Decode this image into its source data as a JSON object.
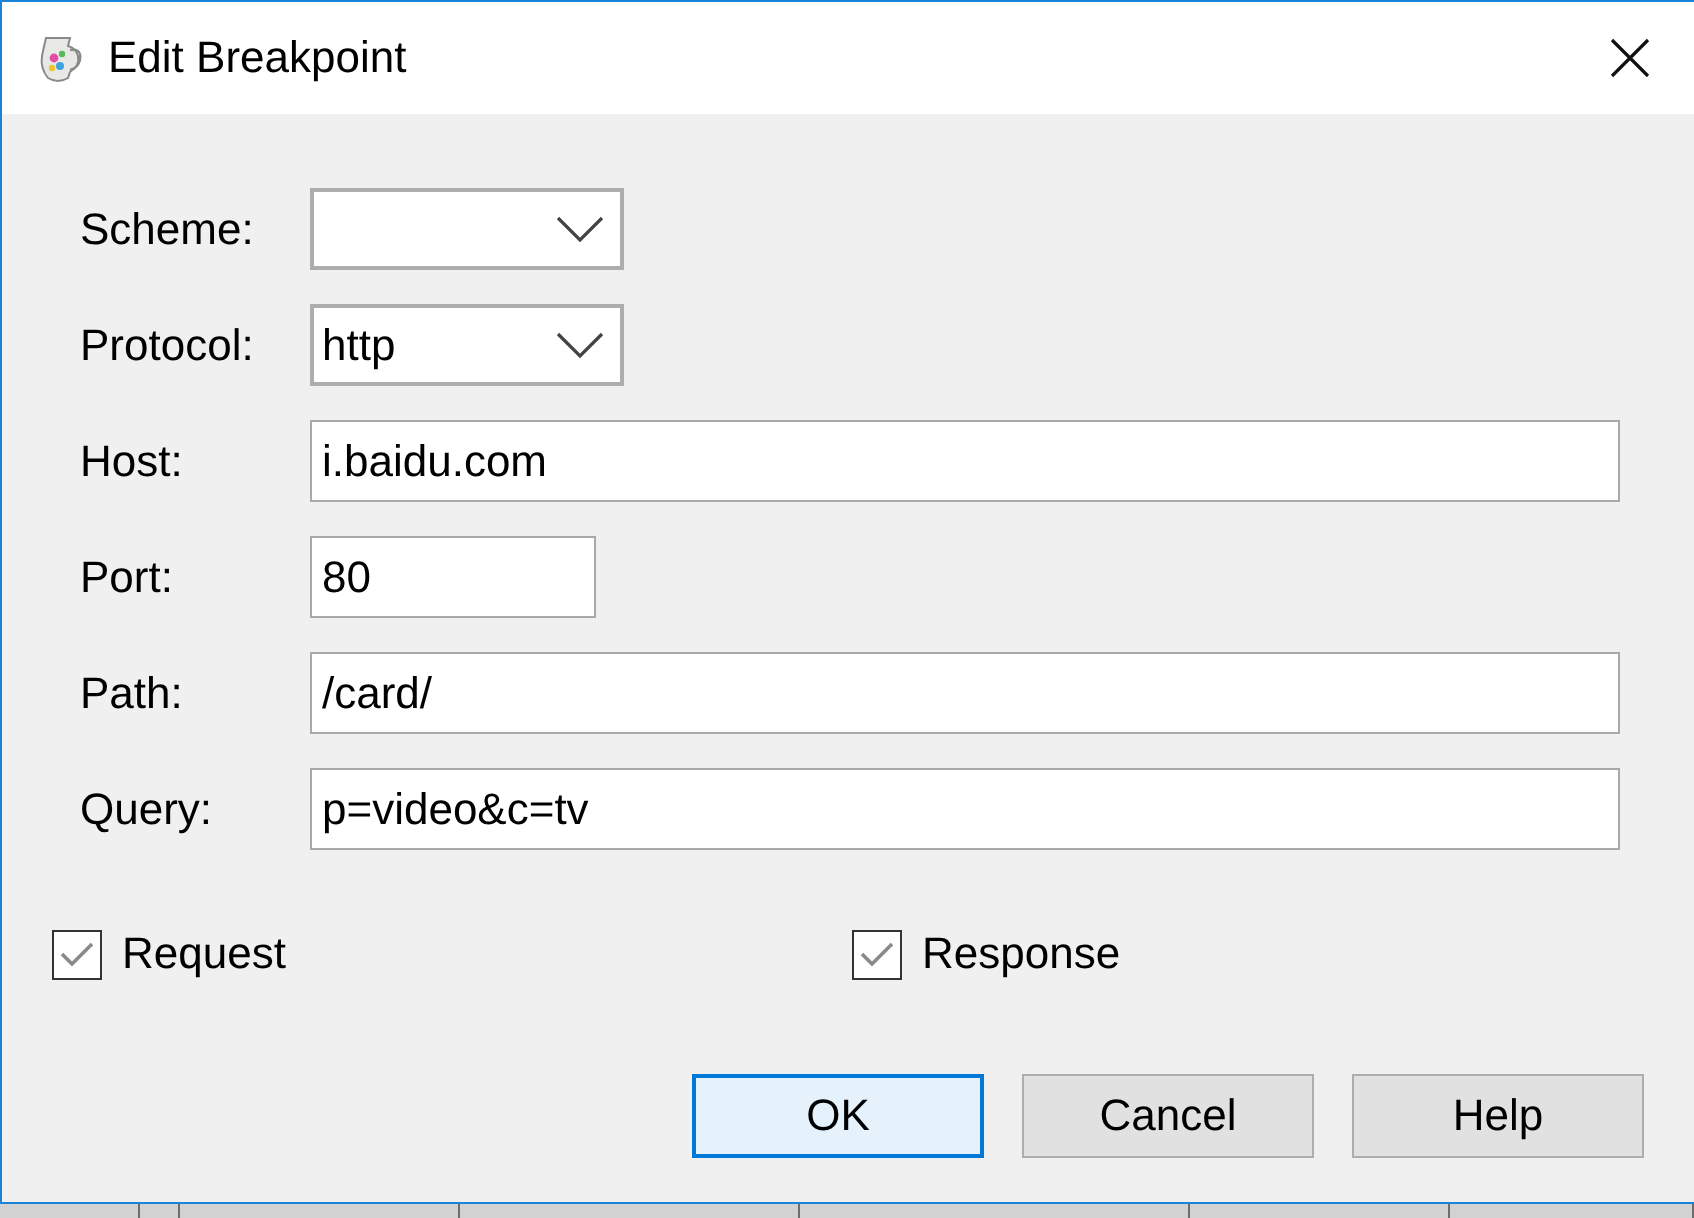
{
  "window": {
    "title": "Edit Breakpoint"
  },
  "fields": [
    {
      "label": "Scheme:",
      "kind": "dropdown"
    },
    {
      "label": "Protocol:",
      "kind": "dropdown",
      "value": "http"
    },
    {
      "label": "Host:",
      "kind": "text",
      "value": "i.baidu.com"
    },
    {
      "label": "Port:",
      "kind": "number",
      "value": "80"
    },
    {
      "label": "Path:",
      "kind": "text",
      "value": "/card/"
    },
    {
      "label": "Query:",
      "kind": "text",
      "value": "p=video&c=tv"
    }
  ],
  "checkboxes": [
    {
      "label": "Request",
      "checked": true
    },
    {
      "label": "Response",
      "checked": true
    }
  ],
  "buttons": [
    {
      "label": "OK",
      "default": true
    },
    {
      "label": "Cancel",
      "default": false
    },
    {
      "label": "Help",
      "default": false
    }
  ]
}
